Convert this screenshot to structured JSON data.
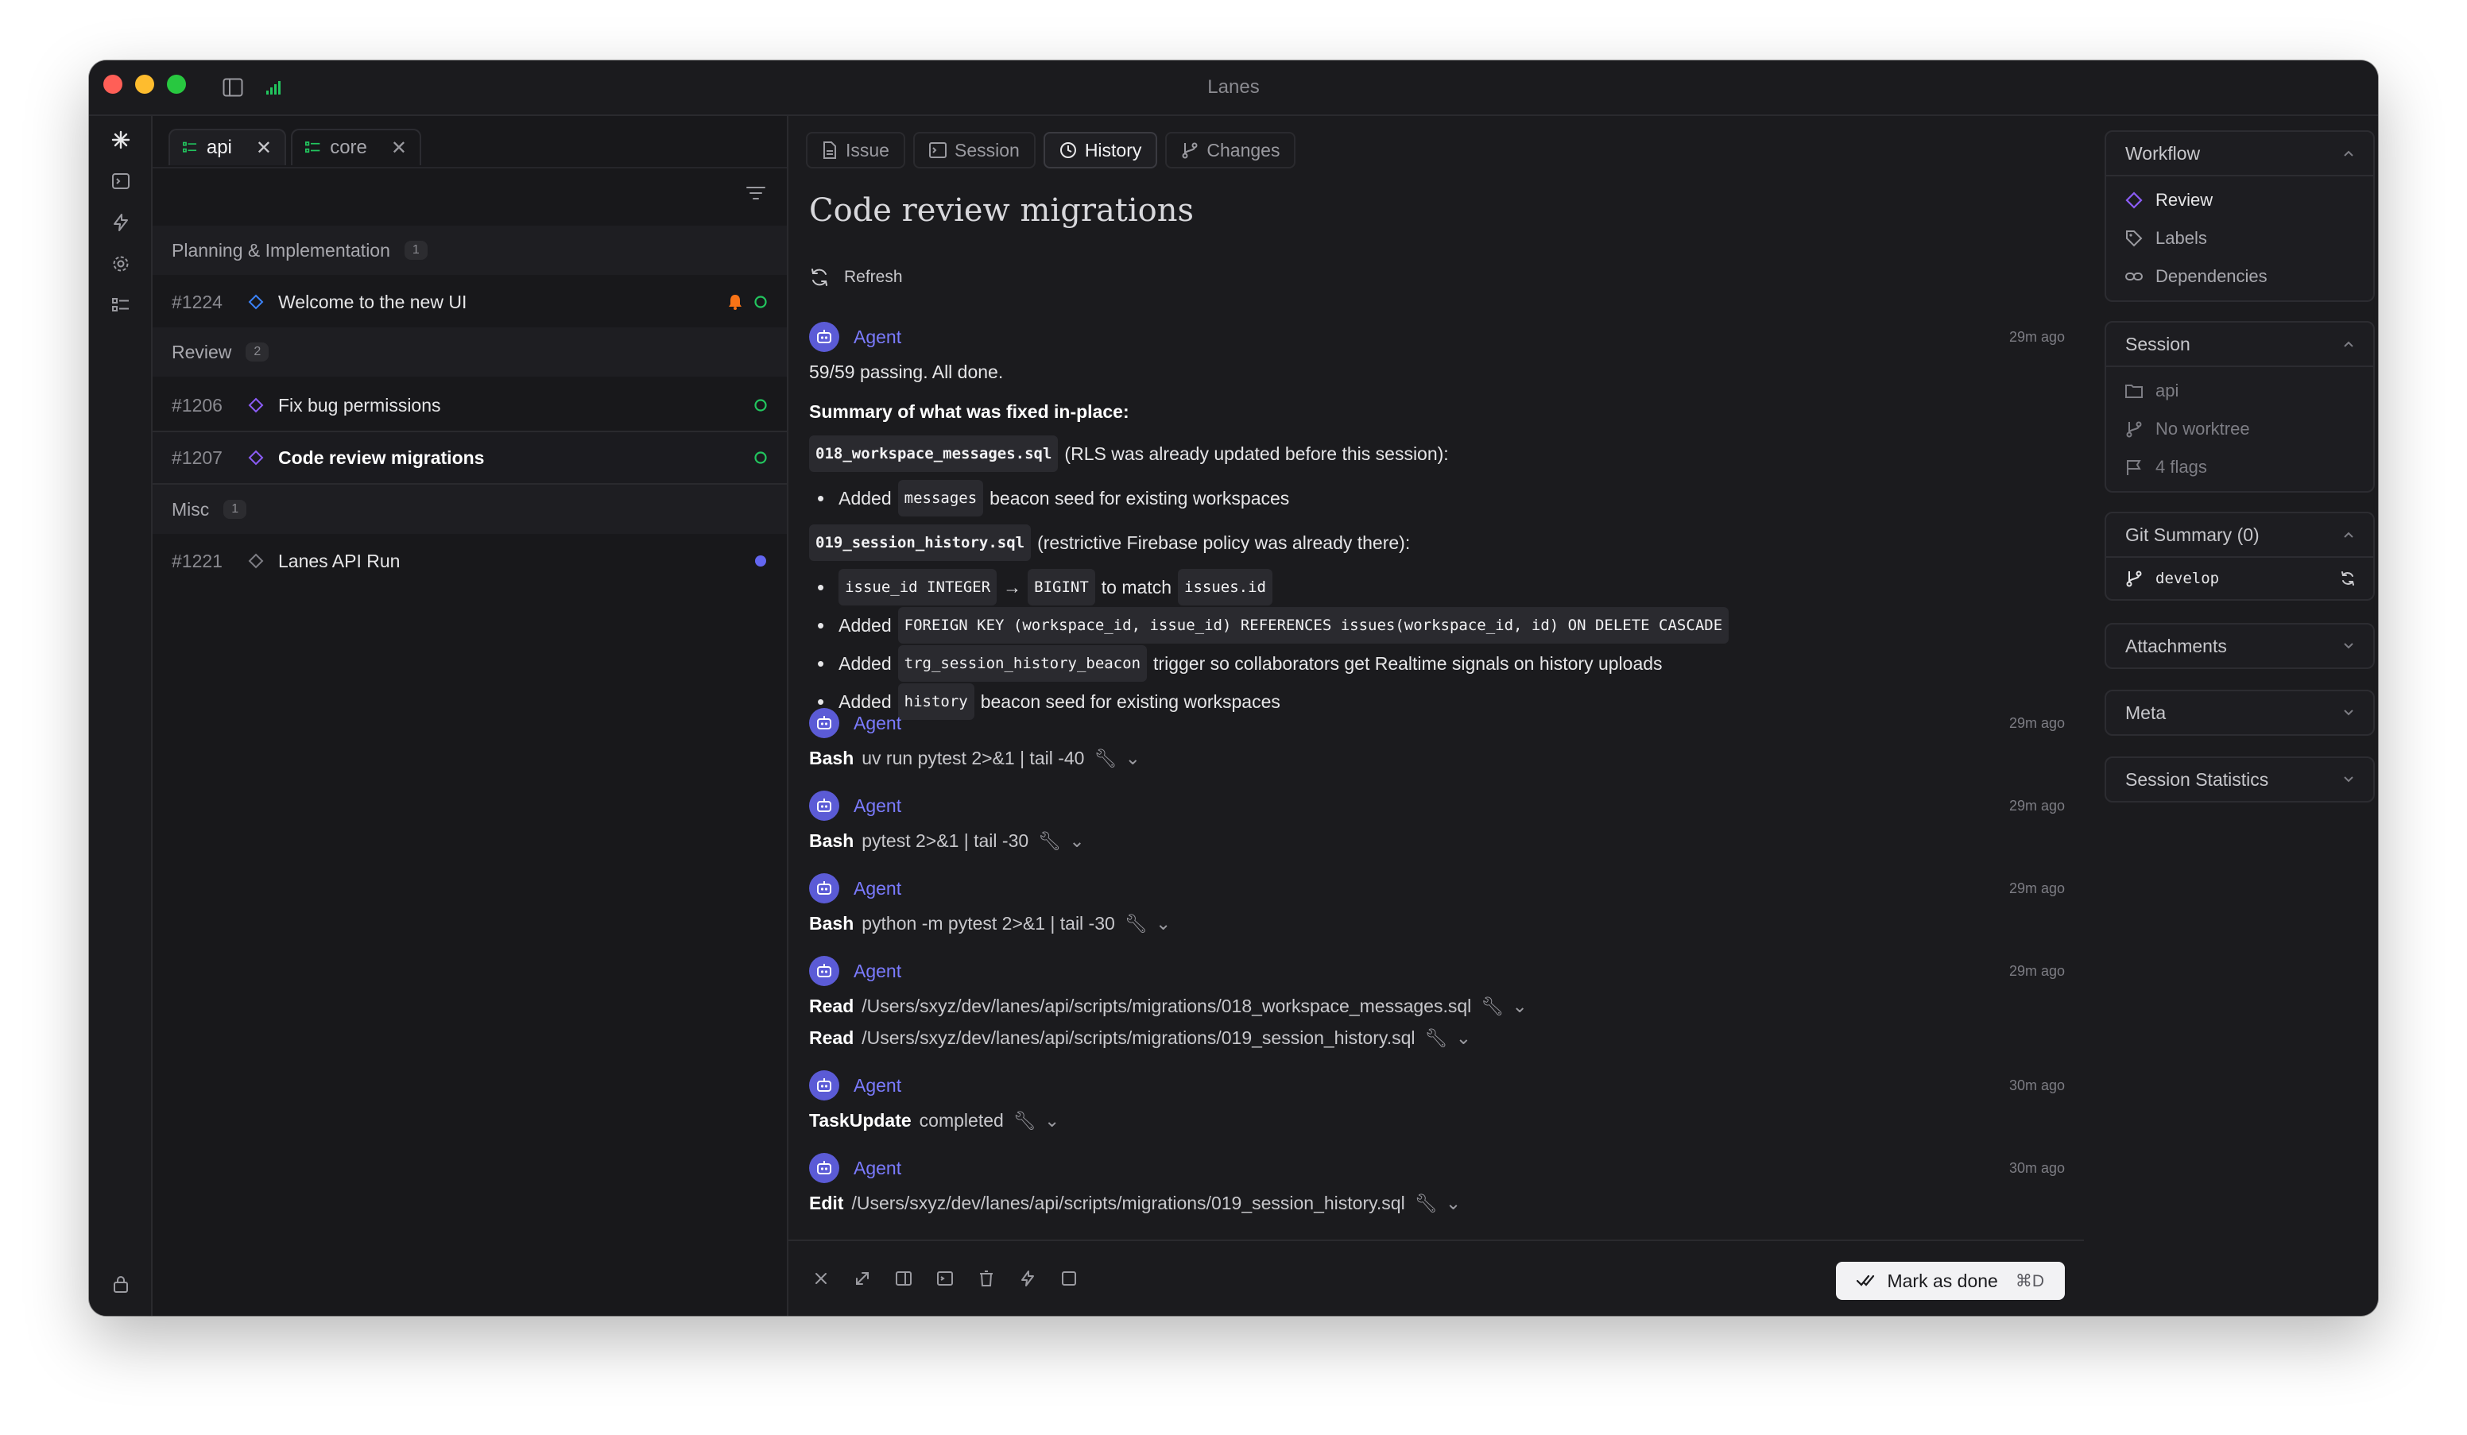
{
  "window": {
    "title": "Lanes"
  },
  "rail": {
    "icons": [
      "sparkle-icon",
      "terminal-icon",
      "bolt-icon",
      "gear-icon",
      "tasks-icon",
      "lock-icon"
    ]
  },
  "tabs": [
    {
      "label": "api",
      "active": true
    },
    {
      "label": "core",
      "active": false
    }
  ],
  "groups": [
    {
      "name": "Planning & Implementation",
      "count": "1",
      "items": [
        {
          "num": "#1224",
          "title": "Welcome to the new UI",
          "has_bell": true,
          "status": "open"
        }
      ]
    },
    {
      "name": "Review",
      "count": "2",
      "items": [
        {
          "num": "#1206",
          "title": "Fix bug permissions",
          "status": "open"
        },
        {
          "num": "#1207",
          "title": "Code review migrations",
          "status": "open",
          "selected": true
        }
      ]
    },
    {
      "name": "Misc",
      "count": "1",
      "items": [
        {
          "num": "#1221",
          "title": "Lanes API Run",
          "status": "running"
        }
      ]
    }
  ],
  "view_tabs": [
    {
      "label": "Issue",
      "icon": "document-icon"
    },
    {
      "label": "Session",
      "icon": "terminal-icon"
    },
    {
      "label": "History",
      "icon": "clock-icon",
      "active": true
    },
    {
      "label": "Changes",
      "icon": "branch-icon"
    }
  ],
  "main": {
    "title": "Code review migrations",
    "refresh_label": "Refresh",
    "agent_name": "Agent"
  },
  "history": [
    {
      "time": "29m ago",
      "summary": {
        "status": "59/59 passing. All done.",
        "heading": "Summary of what was fixed in-place:",
        "file1": "018_workspace_messages.sql",
        "file1_note": "(RLS was already updated before this session):",
        "b1_pre": "Added",
        "b1_code": "messages",
        "b1_post": "beacon seed for existing workspaces",
        "file2": "019_session_history.sql",
        "file2_note": "(restrictive Firebase policy was already there):",
        "b2_code1": "issue_id INTEGER",
        "b2_arrow": "→",
        "b2_code2": "BIGINT",
        "b2_mid": "to match",
        "b2_code3": "issues.id",
        "b3_pre": "Added",
        "b3_code": "FOREIGN KEY (workspace_id, issue_id) REFERENCES issues(workspace_id, id) ON DELETE CASCADE",
        "b4_pre": "Added",
        "b4_code": "trg_session_history_beacon",
        "b4_post": "trigger so collaborators get Realtime signals on history uploads",
        "b5_pre": "Added",
        "b5_code": "history",
        "b5_post": "beacon seed for existing workspaces"
      }
    },
    {
      "time": "29m ago",
      "tool": "Bash",
      "arg": "uv run pytest 2>&1 | tail -40"
    },
    {
      "time": "29m ago",
      "tool": "Bash",
      "arg": "pytest 2>&1 | tail -30"
    },
    {
      "time": "29m ago",
      "tool": "Bash",
      "arg": "python -m pytest 2>&1 | tail -30"
    },
    {
      "time": "29m ago",
      "tool": "Read",
      "arg": "/Users/sxyz/dev/lanes/api/scripts/migrations/018_workspace_messages.sql",
      "tool2": "Read",
      "arg2": "/Users/sxyz/dev/lanes/api/scripts/migrations/019_session_history.sql"
    },
    {
      "time": "30m ago",
      "tool": "TaskUpdate",
      "arg": "completed"
    },
    {
      "time": "30m ago",
      "tool": "Edit",
      "arg": "/Users/sxyz/dev/lanes/api/scripts/migrations/019_session_history.sql"
    }
  ],
  "bottombar": {
    "icons": [
      "close-icon",
      "expand-icon",
      "split-panel-icon",
      "terminal-icon",
      "trash-icon",
      "bolt-icon",
      "square-icon"
    ],
    "done_label": "Mark as done",
    "done_shortcut": "⌘D"
  },
  "right": {
    "workflow": {
      "title": "Workflow",
      "items": [
        "Review",
        "Labels",
        "Dependencies"
      ]
    },
    "session": {
      "title": "Session",
      "items": [
        "api",
        "No worktree",
        "4 flags"
      ]
    },
    "git": {
      "title": "Git Summary (0)",
      "branch": "develop"
    },
    "attachments": {
      "title": "Attachments"
    },
    "meta": {
      "title": "Meta"
    },
    "stats": {
      "title": "Session Statistics"
    }
  },
  "colors": {
    "accent": "#7b7bff",
    "status_open": "#22c55e",
    "status_running": "#6366f1",
    "bell": "#f97316",
    "diamond_blue": "#3b82f6",
    "diamond_purple": "#8b5cf6"
  }
}
